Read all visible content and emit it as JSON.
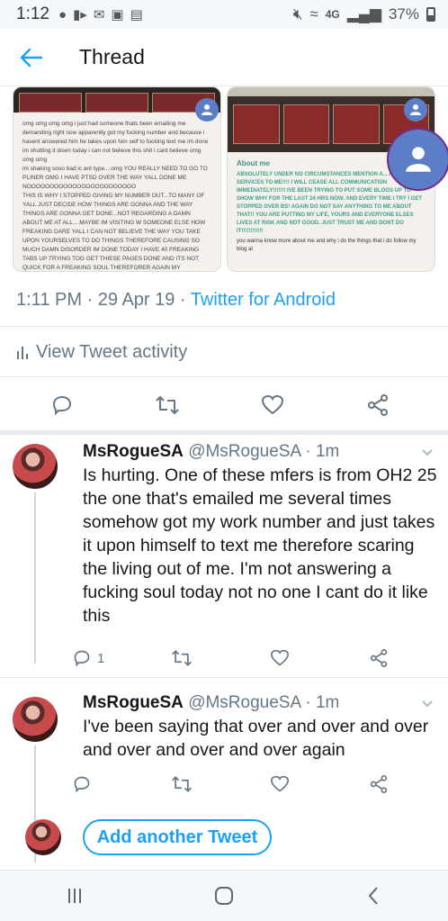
{
  "status_bar": {
    "time": "1:12",
    "network": "4G",
    "battery": "37%"
  },
  "header": {
    "title": "Thread"
  },
  "tweet": {
    "images": {
      "left_text": "omg omg omg omg i just had someone thats been emailing me demanding right now apparently got my fucking number and because i havent answered him he takes upon him self to fucking text me im done im shutting it down today i can not believe this shit i cant believe omg omg omg\nim shaking sooo bad ic ant type....omg YOU REALLY NEED TO GO TO PLINER OMG I HAVE PTSD OVER THE WAY YALL DONE ME NOOOOOOOOOOOOOOOOOOOOOOOO\nTHIS IS WHY I STOPPED GIVING MY NUMBER OUT...TO MANY OF YALL JUST DECIDE HOW THINGS ARE GONNA AND THE WAY THINGS ARE GONNA GET DONE...NOT REGARDING A DAMN ABOUT ME AT ALL....MAYBE IM VISITING W SOMEONE ELSE HOW FREAKING DARE YALL I CAN NOT BELIEVE THE WAY YOU TAKE UPON YOURSELVES TO DO THINGS THEREFORE CAUSING SO MUCH DAMN DISORDER IM DONE TODAY I HAVE 40 FREAKING TABS UP TRYING TOG GET THIESE PAGES DONE AND ITS NOT QUICK FOR A FREAKING SOUL THEREFORER AGAIN MY",
      "right_about": "About me",
      "right_green": "ABSOLUTELY UNDER NO CIRCUMSTANCES MENTION A... AND/OR SERVICES TO ME!!!! I WILL CEASE ALL COMMUNICATION IMMEDIATELY!!!!!!! IVE BEEN TRYING TO PUT SOME BLOGS UP TO SHOW WHY FOR THE LAST 24 HRS NOW, AND EVERY TIME I TRY I GET STOPPED OVER BS! AGAIN DO NOT SAY ANYTHING TO ME ABOUT THAT!! YOU ARE PUTTING MY LIFE, YOURS AND EVERYONE ELSES LIVES AT RISK AND NOT GOOD. JUST TRUST ME AND DONT DO IT!!!!!!!!!!!!",
      "right_dark": "you wanna know more about me and why i do the things that i do follow my blog at"
    },
    "timestamp": "1:11 PM · 29 Apr 19 · ",
    "source": "Twitter for Android",
    "activity_label": "View Tweet activity"
  },
  "replies": [
    {
      "name": "MsRogueSA",
      "handle": "@MsRogueSA · 1m",
      "text": "Is hurting. One of these mfers is from OH2 25 the one that's emailed me several times somehow  got my work number and just takes it upon himself  to text me therefore scaring the living out of me. I'm not answering a fucking soul today not no one I cant do it like this",
      "reply_count": "1"
    },
    {
      "name": "MsRogueSA",
      "handle": "@MsRogueSA · 1m",
      "text": "I've been saying that over and over and over and over and over and over again",
      "reply_count": ""
    }
  ],
  "compose": {
    "add_label": "Add another Tweet"
  },
  "colors": {
    "accent": "#1da1f2",
    "muted": "#657786"
  }
}
